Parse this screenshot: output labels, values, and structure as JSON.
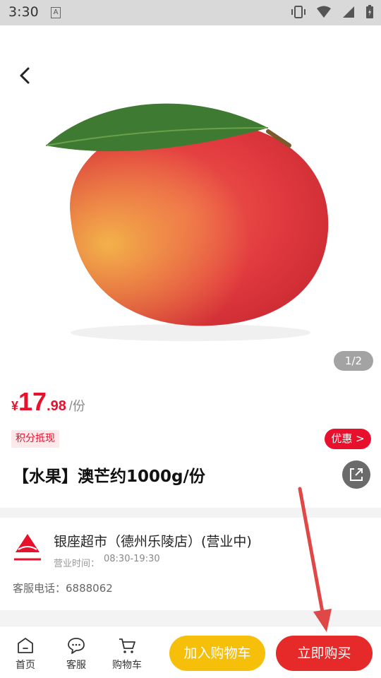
{
  "status_bar": {
    "time": "3:30",
    "notif_letter": "A"
  },
  "gallery": {
    "indicator": "1/2"
  },
  "price": {
    "symbol": "¥",
    "integer": "17",
    "decimal": ".98",
    "unit": "/份"
  },
  "tags": {
    "points": "积分抵现",
    "discount": "优惠 >"
  },
  "product": {
    "title": "【水果】澳芒约1000g/份"
  },
  "store": {
    "name": "银座超市（德州乐陵店）(营业中)",
    "hours_label": "营业时间：",
    "hours": "08:30-19:30",
    "phone": "客服电话：6888062"
  },
  "bottom_nav": {
    "home": "首页",
    "service": "客服",
    "cart": "购物车",
    "add_to_cart": "加入购物车",
    "buy_now": "立即购买"
  },
  "colors": {
    "accent_red": "#e8112d",
    "cart_yellow": "#f6bf0a",
    "buy_red": "#e62a2a"
  }
}
